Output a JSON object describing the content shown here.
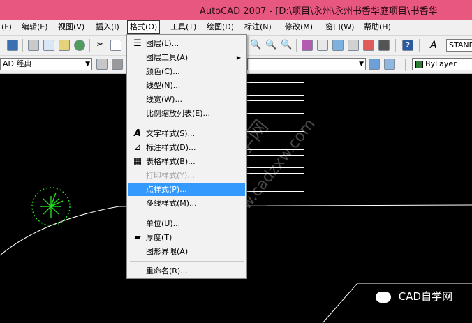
{
  "window": {
    "title": "AutoCAD 2007 - [D:\\项目\\永州\\永州书香华庭项目\\书香华"
  },
  "menubar": {
    "items": [
      {
        "label": "(F)"
      },
      {
        "label": "编辑(E)"
      },
      {
        "label": "视图(V)"
      },
      {
        "label": "插入(I)"
      },
      {
        "label": "格式(O)"
      },
      {
        "label": "工具(T)"
      },
      {
        "label": "绘图(D)"
      },
      {
        "label": "标注(N)"
      },
      {
        "label": "修改(M)"
      },
      {
        "label": "窗口(W)"
      },
      {
        "label": "帮助(H)"
      }
    ],
    "active_index": 4
  },
  "toolbar": {
    "text_style_value": "STANDA",
    "workspace_value": "AD 经典",
    "color_value": "ByLayer"
  },
  "format_menu": {
    "items": [
      {
        "label": "图层(L)...",
        "icon": "layers-icon"
      },
      {
        "label": "图层工具(A)",
        "submenu": true
      },
      {
        "label": "颜色(C)..."
      },
      {
        "label": "线型(N)..."
      },
      {
        "label": "线宽(W)..."
      },
      {
        "label": "比例缩放列表(E)..."
      },
      {
        "label": "文字样式(S)...",
        "icon": "text-style-icon"
      },
      {
        "label": "标注样式(D)...",
        "icon": "dimension-style-icon"
      },
      {
        "label": "表格样式(B)...",
        "icon": "table-style-icon"
      },
      {
        "label": "打印样式(Y)...",
        "disabled": true
      },
      {
        "label": "点样式(P)...",
        "highlighted": true
      },
      {
        "label": "多线样式(M)..."
      },
      {
        "label": "单位(U)..."
      },
      {
        "label": "厚度(T)",
        "icon": "thickness-icon"
      },
      {
        "label": "图形界限(A)"
      },
      {
        "label": "重命名(R)..."
      }
    ]
  },
  "watermark": {
    "text_cn": "CAD自学网",
    "text_url": "www.cadzxw.com"
  },
  "brand": {
    "label": "CAD自学网"
  },
  "colors": {
    "titlebar": "#e8577f",
    "highlight": "#3399ff",
    "canvas": "#000000",
    "bylayer_swatch": "#2e7d32"
  }
}
